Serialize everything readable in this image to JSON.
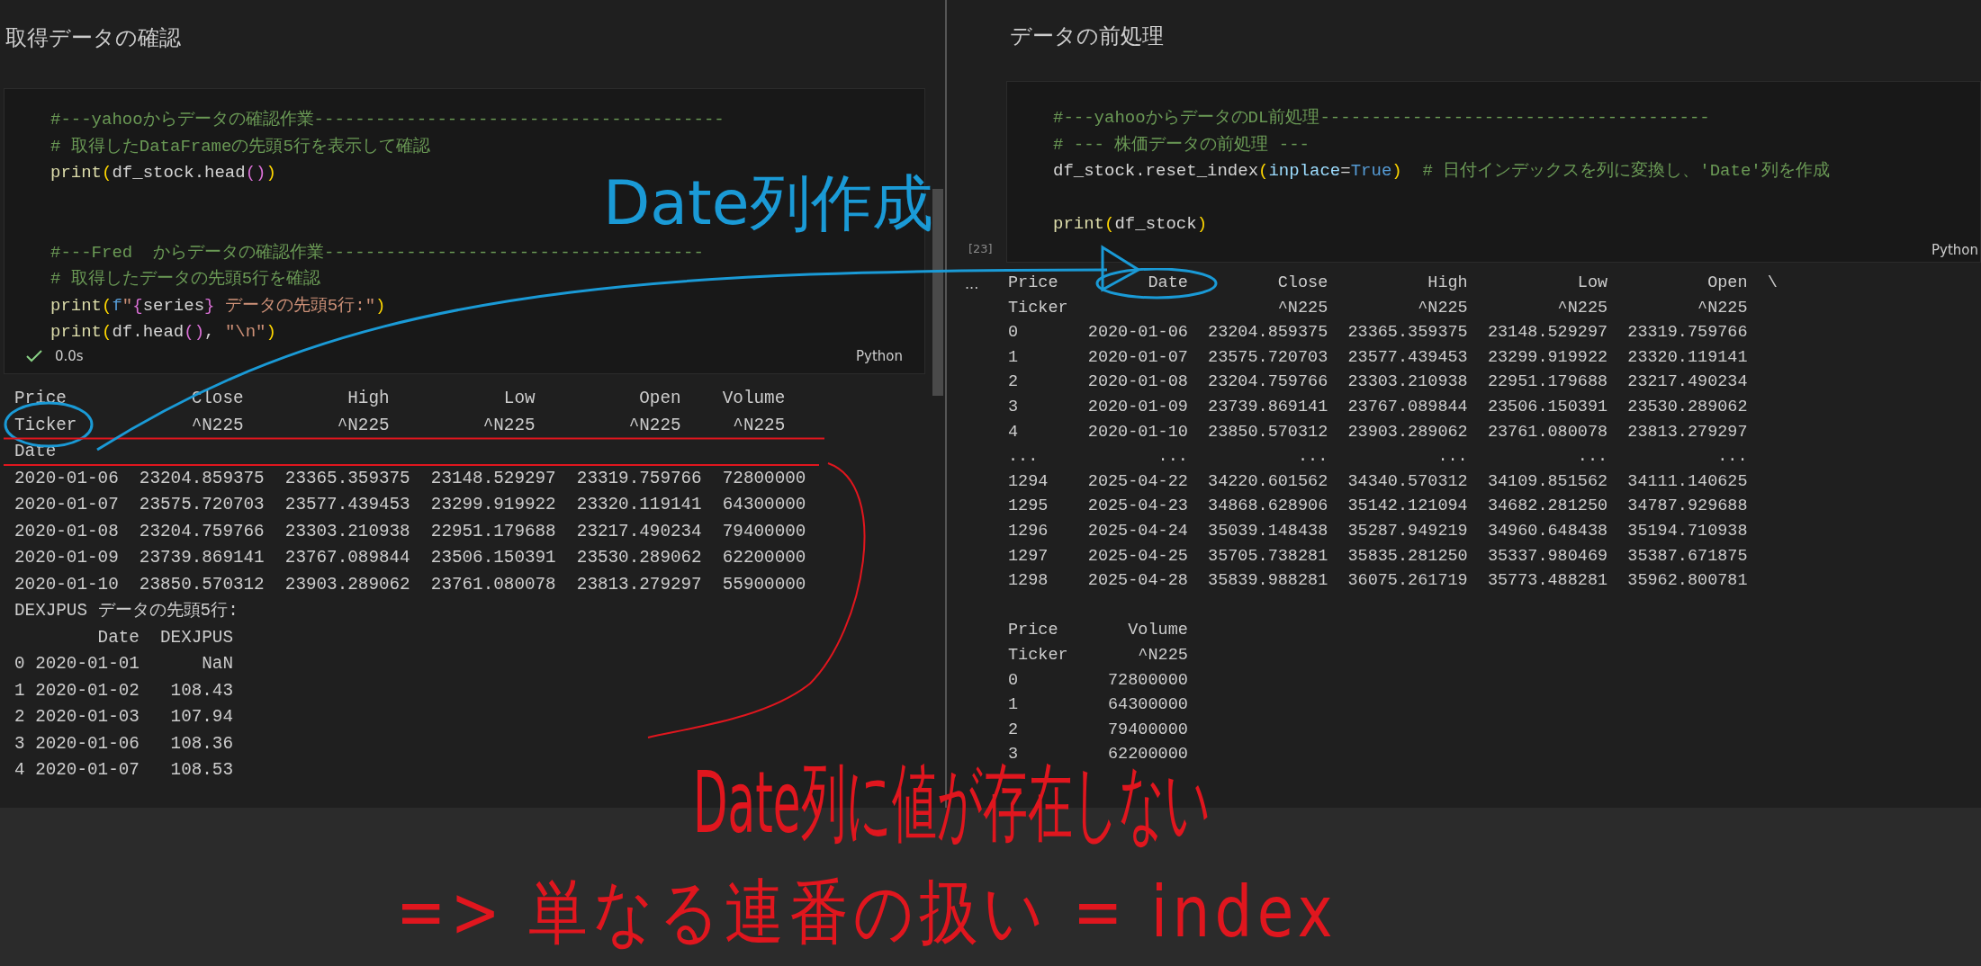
{
  "left_pane": {
    "heading": "取得データの確認",
    "cell": {
      "code_blocks": [
        [
          [
            {
              "t": "#---yahooからデータの確認作業----------------------------------------",
              "kind": "comment"
            }
          ],
          [
            {
              "t": "# 取得したDataFrameの先頭5行を表示して確認",
              "kind": "comment"
            }
          ],
          [
            {
              "t": "print",
              "kind": "func"
            },
            {
              "t": "(",
              "kind": "bracket1"
            },
            {
              "t": "df_stock.head",
              "kind": "text"
            },
            {
              "t": "()",
              "kind": "bracket2"
            },
            {
              "t": ")",
              "kind": "bracket1"
            }
          ]
        ],
        [
          [
            {
              "t": "#---Fred  からデータの確認作業-------------------------------------",
              "kind": "comment"
            }
          ],
          [
            {
              "t": "# 取得したデータの先頭5行を確認",
              "kind": "comment"
            }
          ],
          [
            {
              "t": "print",
              "kind": "func"
            },
            {
              "t": "(",
              "kind": "bracket1"
            },
            {
              "t": "f",
              "kind": "keyword"
            },
            {
              "t": "\"",
              "kind": "string"
            },
            {
              "t": "{",
              "kind": "bracket2"
            },
            {
              "t": "series",
              "kind": "text"
            },
            {
              "t": "}",
              "kind": "bracket2"
            },
            {
              "t": " データの先頭5行:\"",
              "kind": "string"
            },
            {
              "t": ")",
              "kind": "bracket1"
            }
          ],
          [
            {
              "t": "print",
              "kind": "func"
            },
            {
              "t": "(",
              "kind": "bracket1"
            },
            {
              "t": "df.head",
              "kind": "text"
            },
            {
              "t": "()",
              "kind": "bracket2"
            },
            {
              "t": ", ",
              "kind": "text"
            },
            {
              "t": "\"\\n\"",
              "kind": "string"
            },
            {
              "t": ")",
              "kind": "bracket1"
            }
          ]
        ]
      ],
      "success": true,
      "duration": "0.0s",
      "language": "Python"
    },
    "output_lines": [
      "Price            Close          High           Low          Open    Volume",
      "Ticker           ^N225         ^N225         ^N225         ^N225     ^N225",
      "Date",
      "2020-01-06  23204.859375  23365.359375  23148.529297  23319.759766  72800000",
      "2020-01-07  23575.720703  23577.439453  23299.919922  23320.119141  64300000",
      "2020-01-08  23204.759766  23303.210938  22951.179688  23217.490234  79400000",
      "2020-01-09  23739.869141  23767.089844  23506.150391  23530.289062  62200000",
      "2020-01-10  23850.570312  23903.289062  23761.080078  23813.279297  55900000",
      "DEXJPUS データの先頭5行:",
      "        Date  DEXJPUS",
      "0 2020-01-01      NaN",
      "1 2020-01-02   108.43",
      "2 2020-01-03   107.94",
      "3 2020-01-06   108.36",
      "4 2020-01-07   108.53"
    ]
  },
  "right_pane": {
    "heading": "データの前処理",
    "cell": {
      "code_blocks": [
        [
          [
            {
              "t": "#---yahooからデータのDL前処理--------------------------------------",
              "kind": "comment"
            }
          ],
          [
            {
              "t": "# --- 株価データの前処理 ---",
              "kind": "comment"
            }
          ],
          [
            {
              "t": "df_stock.reset_index",
              "kind": "text"
            },
            {
              "t": "(",
              "kind": "bracket1"
            },
            {
              "t": "inplace",
              "kind": "param"
            },
            {
              "t": "=",
              "kind": "text"
            },
            {
              "t": "True",
              "kind": "keyword"
            },
            {
              "t": ")",
              "kind": "bracket1"
            },
            {
              "t": "  # 日付インデックスを列に変換し、'Date'列を作成",
              "kind": "comment"
            }
          ]
        ],
        [
          [
            {
              "t": "print",
              "kind": "func"
            },
            {
              "t": "(",
              "kind": "bracket1"
            },
            {
              "t": "df_stock",
              "kind": "text"
            },
            {
              "t": ")",
              "kind": "bracket1"
            }
          ]
        ]
      ],
      "execution_count": "[23]",
      "language": "Python"
    },
    "output_marker": "...",
    "output_blocks": [
      [
        "Price         Date         Close          High           Low          Open  \\",
        "Ticker                     ^N225         ^N225         ^N225         ^N225",
        "0       2020-01-06  23204.859375  23365.359375  23148.529297  23319.759766",
        "1       2020-01-07  23575.720703  23577.439453  23299.919922  23320.119141",
        "2       2020-01-08  23204.759766  23303.210938  22951.179688  23217.490234",
        "3       2020-01-09  23739.869141  23767.089844  23506.150391  23530.289062",
        "4       2020-01-10  23850.570312  23903.289062  23761.080078  23813.279297",
        "...            ...           ...           ...           ...           ...",
        "1294    2025-04-22  34220.601562  34340.570312  34109.851562  34111.140625",
        "1295    2025-04-23  34868.628906  35142.121094  34682.281250  34787.929688",
        "1296    2025-04-24  35039.148438  35287.949219  34960.648438  35194.710938",
        "1297    2025-04-25  35705.738281  35835.281250  35337.980469  35387.671875",
        "1298    2025-04-28  35839.988281  36075.261719  35773.488281  35962.800781"
      ],
      [
        "Price       Volume",
        "Ticker       ^N225",
        "0         72800000",
        "1         64300000",
        "2         79400000",
        "3         62200000"
      ]
    ]
  },
  "annotations": [
    {
      "text": "Date列作成",
      "color": "#1a9ad6"
    },
    {
      "text": "Date列に値が存在しない",
      "color": "#e0161e"
    },
    {
      "text": "=> 単なる連番の扱い = index",
      "color": "#e0161e"
    }
  ]
}
